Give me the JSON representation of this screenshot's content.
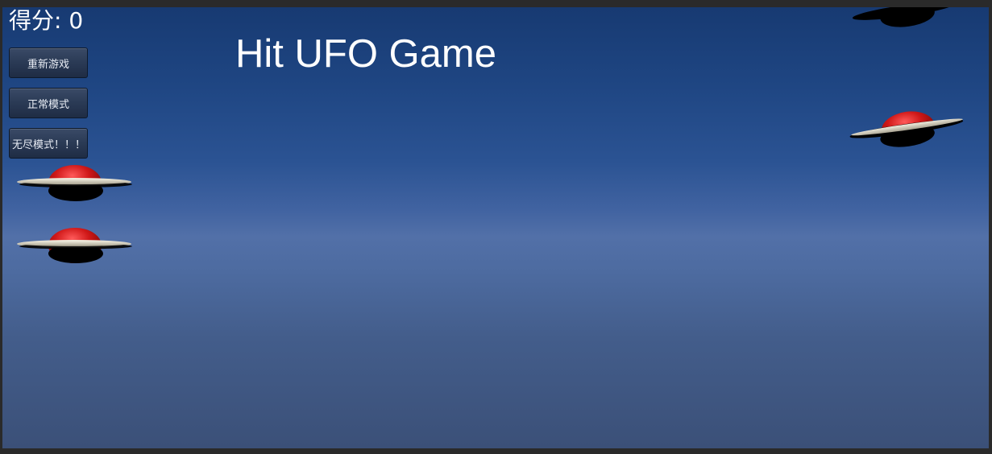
{
  "hud": {
    "score_label": "得分: 0",
    "title": "Hit UFO Game"
  },
  "buttons": {
    "restart": "重新游戏",
    "normal_mode": "正常模式",
    "endless_mode": "无尽模式！！！"
  },
  "colors": {
    "sky_top": "#173a72",
    "sky_mid": "#5270a8",
    "sky_bottom": "#3b5078",
    "ufo_dome": "#d01818",
    "ufo_disc": "#d8d2bd",
    "ufo_shadow": "#000000",
    "text": "#ffffff",
    "button_bg": "#2a3a55"
  }
}
